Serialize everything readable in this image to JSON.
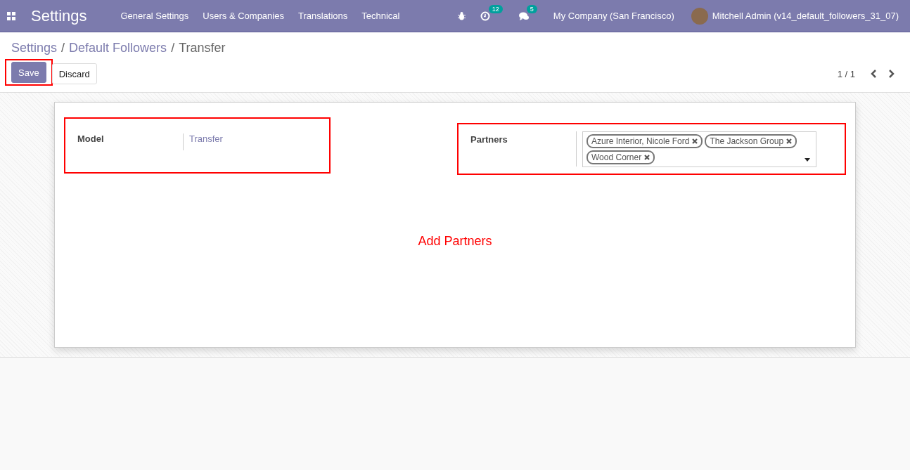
{
  "navbar": {
    "app_title": "Settings",
    "menu": [
      "General Settings",
      "Users & Companies",
      "Translations",
      "Technical"
    ],
    "activity_count": "12",
    "message_count": "5",
    "company": "My Company (San Francisco)",
    "user": "Mitchell Admin (v14_default_followers_31_07)"
  },
  "breadcrumbs": [
    {
      "label": "Settings",
      "current": false
    },
    {
      "separator": "/",
      "label": "Default Followers",
      "current": false
    },
    {
      "separator": "/",
      "label": "Transfer",
      "current": true
    }
  ],
  "buttons": {
    "save": {
      "label": "Save",
      "highlighted": true
    },
    "discard": {
      "label": "Discard"
    }
  },
  "pager": "1 / 1",
  "form": {
    "model": {
      "label": "Model",
      "value": "Transfer",
      "highlighted": true
    },
    "partners": {
      "label": "Partners",
      "highlighted": true,
      "tags": [
        "Azure Interior, Nicole Ford",
        "The Jackson Group",
        "Wood Corner"
      ]
    },
    "note": "Add Partners"
  }
}
